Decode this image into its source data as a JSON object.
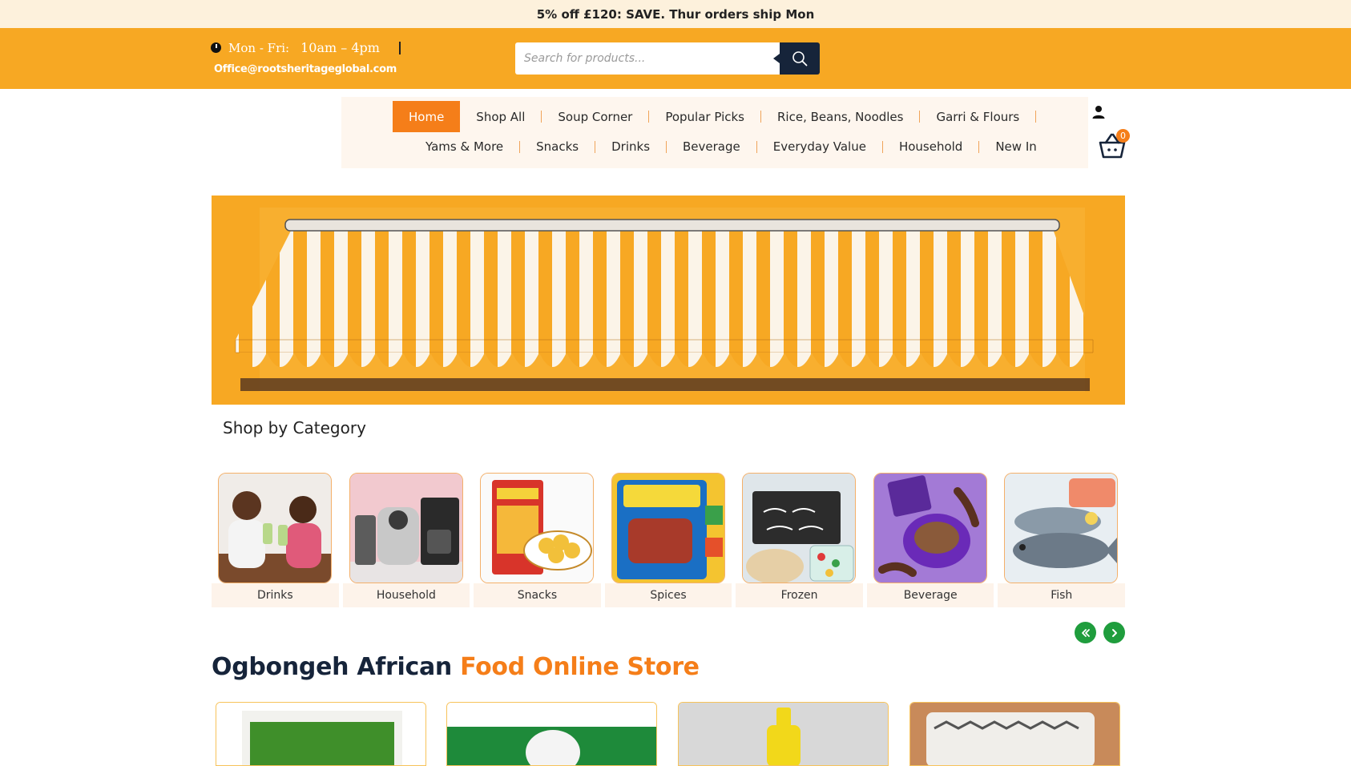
{
  "promo": {
    "text": "5% off £120: SAVE. Thur orders ship Mon"
  },
  "header": {
    "hours_label": "Mon - Fri:",
    "hours_time": "10am – 4pm",
    "email": "Office@rootsheritageglobal.com",
    "search_placeholder": "Search for products..."
  },
  "nav": {
    "row1": [
      "Home",
      "Shop All",
      "Soup Corner",
      "Popular Picks",
      "Rice, Beans, Noodles",
      "Garri & Flours"
    ],
    "row2": [
      "Yams & More",
      "Snacks",
      "Drinks",
      "Beverage",
      "Everyday Value",
      "Household",
      "New In"
    ]
  },
  "cart": {
    "count": "0"
  },
  "categories": {
    "title": "Shop by Category",
    "items": [
      "Drinks",
      "Household",
      "Snacks",
      "Spices",
      "Frozen",
      "Beverage",
      "Fish"
    ]
  },
  "store": {
    "title_main": "Ogbongeh African",
    "title_accent": "Food Online Store"
  },
  "colors": {
    "brand_orange": "#f7a823",
    "accent": "#f57e19",
    "navy": "#16243a",
    "green": "#1f9d3d"
  }
}
